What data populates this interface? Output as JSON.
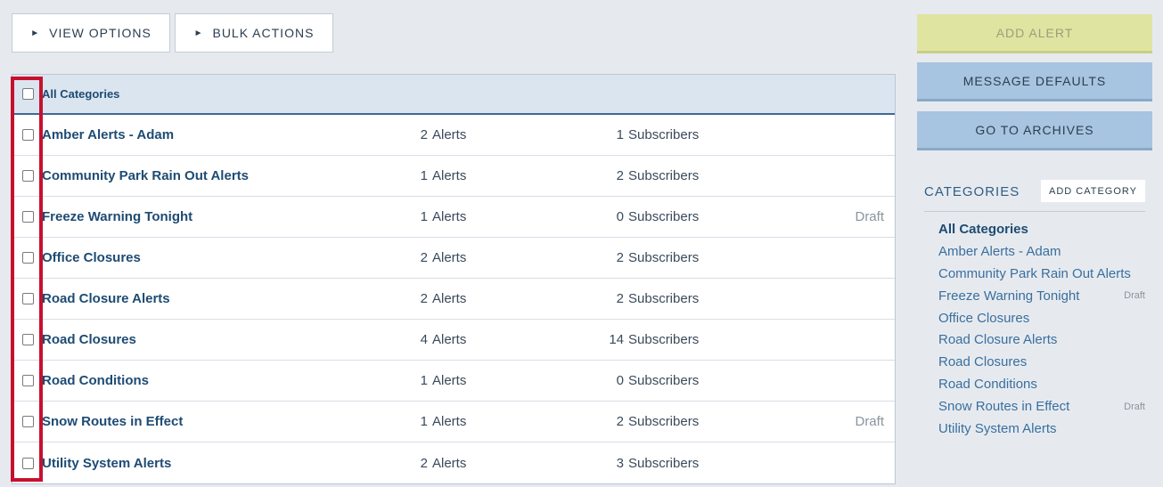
{
  "toolbar": {
    "view_options": "VIEW OPTIONS",
    "bulk_actions": "BULK ACTIONS",
    "triangle": "►"
  },
  "table": {
    "header_label": "All Categories",
    "rows": [
      {
        "name": "Amber Alerts - Adam",
        "alerts": "2",
        "alerts_label": "Alerts",
        "subs": "1",
        "subs_label": "Subscribers",
        "status": ""
      },
      {
        "name": "Community Park Rain Out Alerts",
        "alerts": "1",
        "alerts_label": "Alerts",
        "subs": "2",
        "subs_label": "Subscribers",
        "status": ""
      },
      {
        "name": "Freeze Warning Tonight",
        "alerts": "1",
        "alerts_label": "Alerts",
        "subs": "0",
        "subs_label": "Subscribers",
        "status": "Draft"
      },
      {
        "name": "Office Closures",
        "alerts": "2",
        "alerts_label": "Alerts",
        "subs": "2",
        "subs_label": "Subscribers",
        "status": ""
      },
      {
        "name": "Road Closure Alerts",
        "alerts": "2",
        "alerts_label": "Alerts",
        "subs": "2",
        "subs_label": "Subscribers",
        "status": ""
      },
      {
        "name": "Road Closures",
        "alerts": "4",
        "alerts_label": "Alerts",
        "subs": "14",
        "subs_label": "Subscribers",
        "status": ""
      },
      {
        "name": "Road Conditions",
        "alerts": "1",
        "alerts_label": "Alerts",
        "subs": "0",
        "subs_label": "Subscribers",
        "status": ""
      },
      {
        "name": "Snow Routes in Effect",
        "alerts": "1",
        "alerts_label": "Alerts",
        "subs": "2",
        "subs_label": "Subscribers",
        "status": "Draft"
      },
      {
        "name": "Utility System Alerts",
        "alerts": "2",
        "alerts_label": "Alerts",
        "subs": "3",
        "subs_label": "Subscribers",
        "status": ""
      }
    ]
  },
  "sidebar": {
    "add_alert": "ADD ALERT",
    "message_defaults": "MESSAGE DEFAULTS",
    "go_to_archives": "GO TO ARCHIVES",
    "categories_title": "CATEGORIES",
    "add_category": "ADD CATEGORY",
    "categories": [
      {
        "label": "All Categories",
        "status": ""
      },
      {
        "label": "Amber Alerts - Adam",
        "status": ""
      },
      {
        "label": "Community Park Rain Out Alerts",
        "status": ""
      },
      {
        "label": "Freeze Warning Tonight",
        "status": "Draft"
      },
      {
        "label": "Office Closures",
        "status": ""
      },
      {
        "label": "Road Closure Alerts",
        "status": ""
      },
      {
        "label": "Road Closures",
        "status": ""
      },
      {
        "label": "Road Conditions",
        "status": ""
      },
      {
        "label": "Snow Routes in Effect",
        "status": "Draft"
      },
      {
        "label": "Utility System Alerts",
        "status": ""
      }
    ]
  },
  "colors": {
    "highlight": "#c8102e",
    "link": "#1e4b73",
    "add_alert_bg": "#dfe4a0",
    "secondary_btn_bg": "#a7c4e0"
  }
}
